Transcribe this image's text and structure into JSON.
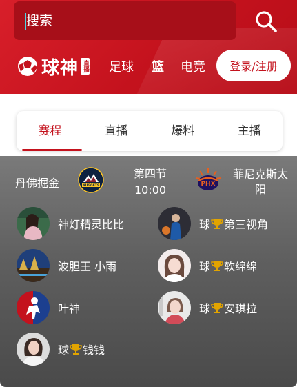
{
  "search": {
    "placeholder": "搜索"
  },
  "brand": {
    "name": "球神",
    "badge": "直播"
  },
  "nav": {
    "items": [
      "足球",
      "篮",
      "电竞"
    ]
  },
  "login": {
    "label": "登录/注册"
  },
  "tabs": [
    "赛程",
    "直播",
    "爆料",
    "主播"
  ],
  "match": {
    "home_team": "丹佛掘金",
    "home_logo_text": "NUGGETS",
    "status_line1": "第四节",
    "status_line2": "10:00",
    "away_team_line1": "菲尼克斯太",
    "away_team_line2": "阳",
    "away_logo_text": "PHX"
  },
  "anchors": [
    {
      "name": "神灯精灵比比",
      "prefix": "",
      "suffix": ""
    },
    {
      "name": "",
      "prefix": "球",
      "suffix": "第三视角"
    },
    {
      "name": "波胆王 小雨",
      "prefix": "",
      "suffix": ""
    },
    {
      "name": "",
      "prefix": "球",
      "suffix": "软绵绵"
    },
    {
      "name": "叶神",
      "prefix": "",
      "suffix": ""
    },
    {
      "name": "",
      "prefix": "球",
      "suffix": "安琪拉"
    },
    {
      "name": "",
      "prefix": "球",
      "suffix": "钱钱"
    }
  ],
  "colors": {
    "brand_red": "#c4121d",
    "header_red": "#d81f2a",
    "trophy_gold": "#e2a400"
  }
}
